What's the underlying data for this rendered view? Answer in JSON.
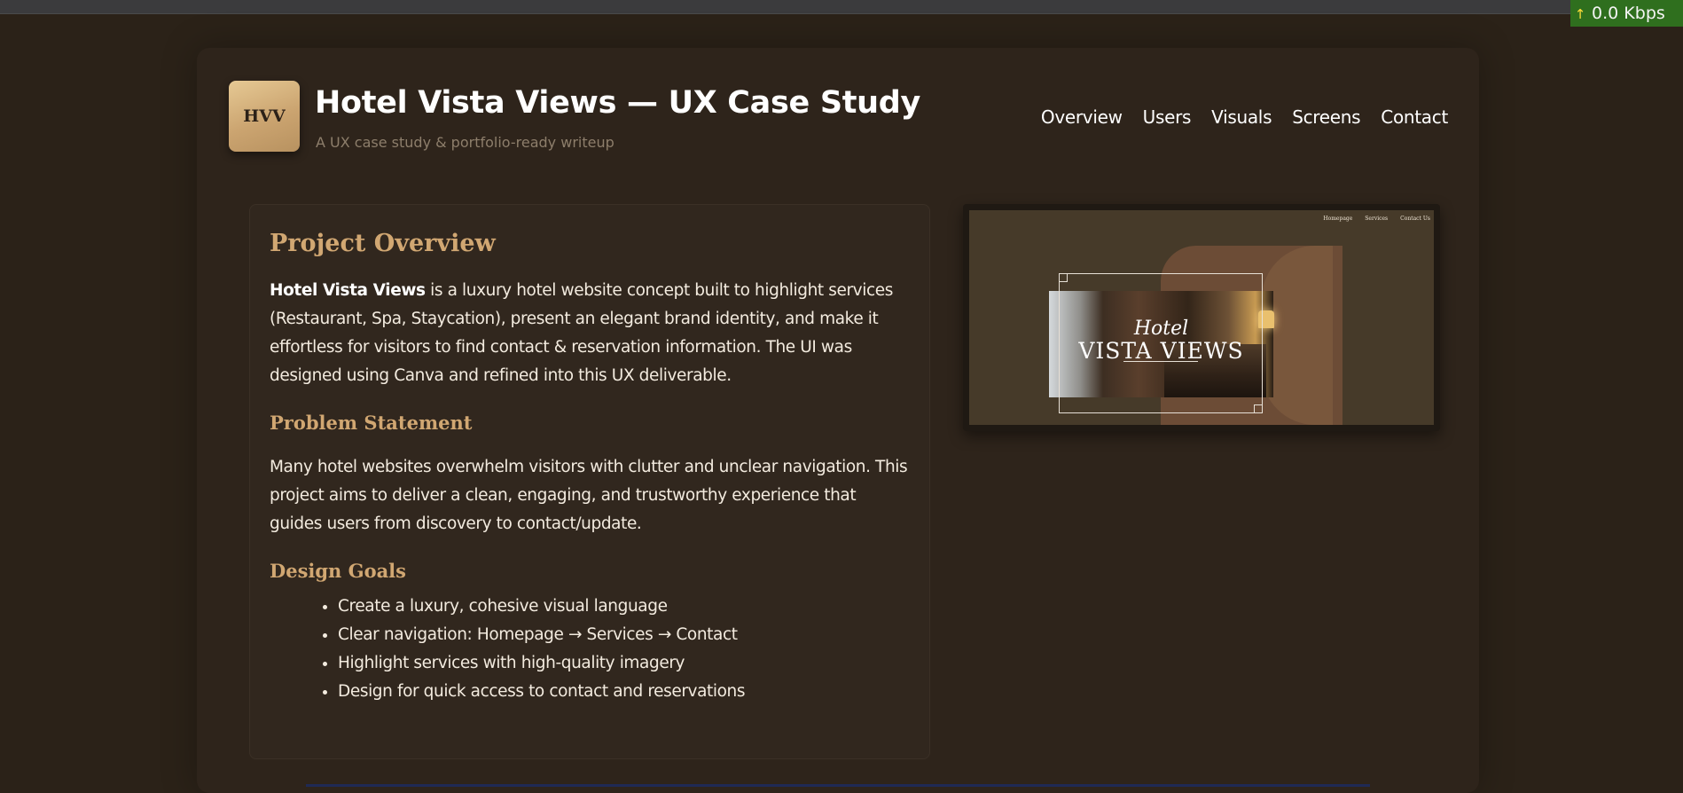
{
  "browser": {
    "net_speed": "0.0 Kbps",
    "arrow_glyph": "↑"
  },
  "header": {
    "logo_text": "HVV",
    "title": "Hotel Vista Views — UX Case Study",
    "tagline": "A UX case study & portfolio-ready writeup",
    "nav": [
      "Overview",
      "Users",
      "Visuals",
      "Screens",
      "Contact"
    ]
  },
  "overview": {
    "heading": "Project Overview",
    "intro_bold": "Hotel Vista Views",
    "intro_rest": " is a luxury hotel website concept built to highlight services (Restaurant, Spa, Staycation), present an elegant brand identity, and make it effortless for visitors to find contact & reservation information. The UI was designed using Canva and refined into this UX deliverable.",
    "problem_heading": "Problem Statement",
    "problem_text": "Many hotel websites overwhelm visitors with clutter and unclear navigation. This project aims to deliver a clean, engaging, and trustworthy experience that guides users from discovery to contact/update.",
    "goals_heading": "Design Goals",
    "goals": [
      "Create a luxury, cohesive visual language",
      "Clear navigation: Homepage → Services → Contact",
      "Highlight services with high-quality imagery",
      "Design for quick access to contact and reservations"
    ]
  },
  "preview": {
    "nav": [
      "Homepage",
      "Services",
      "Contact Us"
    ],
    "script_text": "Hotel",
    "title_text": "VISTA VIEWS"
  },
  "colors": {
    "background": "#2b2218",
    "panel": "#2e241b",
    "accent": "#d1a772",
    "logo_gold": "#cba470",
    "net_badge": "#2f6f1e"
  }
}
